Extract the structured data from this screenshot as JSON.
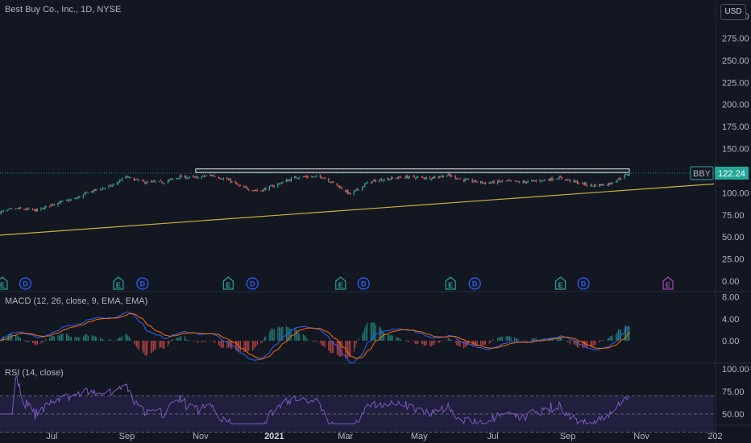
{
  "header": {
    "symbol_title": "Best Buy Co., Inc., 1D, NYSE",
    "currency": "USD"
  },
  "colors": {
    "background": "#131722",
    "up": "#26a69a",
    "down": "#ef5350",
    "trendline": "#c9b23a",
    "resistance_box": "#e8e8e8",
    "macd_line": "#2962ff",
    "signal_line": "#ff6d00",
    "rsi_line": "#7e57c2",
    "rsi_band": "#2a2550",
    "earnings": "#26a69a",
    "dividend": "#2962ff",
    "future_earnings": "#ab47bc",
    "price_tag": "#26a69a"
  },
  "price_tag": {
    "symbol": "BBY",
    "value": "122.24"
  },
  "events": {
    "earnings_label": "E",
    "dividend_label": "D",
    "items": [
      {
        "type": "E",
        "date": "2020-05-21"
      },
      {
        "type": "D",
        "date": "2020-06-09"
      },
      {
        "type": "E",
        "date": "2020-08-25"
      },
      {
        "type": "D",
        "date": "2020-09-14"
      },
      {
        "type": "E",
        "date": "2020-11-24"
      },
      {
        "type": "D",
        "date": "2020-12-14"
      },
      {
        "type": "E",
        "date": "2021-02-25"
      },
      {
        "type": "D",
        "date": "2021-03-16"
      },
      {
        "type": "E",
        "date": "2021-05-27"
      },
      {
        "type": "D",
        "date": "2021-06-16"
      },
      {
        "type": "E",
        "date": "2021-08-26"
      },
      {
        "type": "D",
        "date": "2021-09-14"
      },
      {
        "type": "E-future",
        "date": "2021-11-23"
      }
    ]
  },
  "time_axis": {
    "labels": [
      {
        "text": "Jul",
        "bold": false,
        "date": "2020-07-01"
      },
      {
        "text": "Sep",
        "bold": false,
        "date": "2020-09-01"
      },
      {
        "text": "Nov",
        "bold": false,
        "date": "2020-11-01"
      },
      {
        "text": "2021",
        "bold": true,
        "date": "2021-01-01"
      },
      {
        "text": "Mar",
        "bold": false,
        "date": "2021-03-01"
      },
      {
        "text": "May",
        "bold": false,
        "date": "2021-05-01"
      },
      {
        "text": "Jul",
        "bold": false,
        "date": "2021-07-01"
      },
      {
        "text": "Sep",
        "bold": false,
        "date": "2021-09-01"
      },
      {
        "text": "Nov",
        "bold": false,
        "date": "2021-11-01"
      },
      {
        "text": "202",
        "bold": false,
        "date": "2022-01-01"
      }
    ]
  },
  "macd": {
    "title": "MACD (12, 26, close, 9, EMA, EMA)",
    "ticks": [
      "8.00",
      "4.00",
      "0.00"
    ]
  },
  "rsi": {
    "title": "RSI (14, close)",
    "ticks": [
      "100.00",
      "75.00",
      "50.00"
    ]
  },
  "chart_data": {
    "type": "candlestick",
    "title": "Best Buy Co., Inc., 1D, NYSE",
    "price_axis": {
      "ticks": [
        "300.00",
        "275.00",
        "250.00",
        "225.00",
        "200.00",
        "175.00",
        "150.00",
        "125.00",
        "100.00",
        "75.00",
        "50.00",
        "25.00",
        "0.00"
      ],
      "range": [
        0,
        300
      ]
    },
    "x_range": [
      "2020-05-19",
      "2021-12-31"
    ],
    "last_date": "2021-10-22",
    "close_anchors": [
      {
        "date": "2020-05-19",
        "close": 78
      },
      {
        "date": "2020-06-01",
        "close": 82
      },
      {
        "date": "2020-06-20",
        "close": 80
      },
      {
        "date": "2020-07-01",
        "close": 87
      },
      {
        "date": "2020-07-20",
        "close": 93
      },
      {
        "date": "2020-08-01",
        "close": 101
      },
      {
        "date": "2020-08-20",
        "close": 108
      },
      {
        "date": "2020-08-31",
        "close": 118
      },
      {
        "date": "2020-09-15",
        "close": 112
      },
      {
        "date": "2020-10-01",
        "close": 112
      },
      {
        "date": "2020-10-15",
        "close": 118
      },
      {
        "date": "2020-10-28",
        "close": 117
      },
      {
        "date": "2020-11-10",
        "close": 120
      },
      {
        "date": "2020-11-25",
        "close": 114
      },
      {
        "date": "2020-12-05",
        "close": 106
      },
      {
        "date": "2020-12-20",
        "close": 102
      },
      {
        "date": "2021-01-10",
        "close": 113
      },
      {
        "date": "2021-01-20",
        "close": 118
      },
      {
        "date": "2021-02-10",
        "close": 118
      },
      {
        "date": "2021-02-25",
        "close": 106
      },
      {
        "date": "2021-03-05",
        "close": 98
      },
      {
        "date": "2021-03-20",
        "close": 112
      },
      {
        "date": "2021-04-05",
        "close": 116
      },
      {
        "date": "2021-04-20",
        "close": 118
      },
      {
        "date": "2021-05-10",
        "close": 117
      },
      {
        "date": "2021-05-25",
        "close": 120
      },
      {
        "date": "2021-06-05",
        "close": 115
      },
      {
        "date": "2021-06-25",
        "close": 111
      },
      {
        "date": "2021-07-10",
        "close": 113
      },
      {
        "date": "2021-07-25",
        "close": 112
      },
      {
        "date": "2021-08-10",
        "close": 114
      },
      {
        "date": "2021-08-25",
        "close": 117
      },
      {
        "date": "2021-09-05",
        "close": 113
      },
      {
        "date": "2021-09-20",
        "close": 108
      },
      {
        "date": "2021-10-05",
        "close": 110
      },
      {
        "date": "2021-10-15",
        "close": 117
      },
      {
        "date": "2021-10-22",
        "close": 122.24
      }
    ],
    "resistance_box": {
      "date_start": "2020-10-28",
      "date_end": "2021-10-22",
      "price_low": 123,
      "price_high": 127
    },
    "last_price_line": 122.24,
    "trendline": {
      "points": [
        {
          "date": "2020-05-19",
          "price": 52
        },
        {
          "date": "2021-12-31",
          "price": 110
        }
      ]
    },
    "macd_series": [
      "MACD",
      "Signal",
      "Histogram"
    ],
    "rsi_levels": [
      70,
      50,
      30
    ],
    "rsi_range": [
      0,
      100
    ]
  }
}
